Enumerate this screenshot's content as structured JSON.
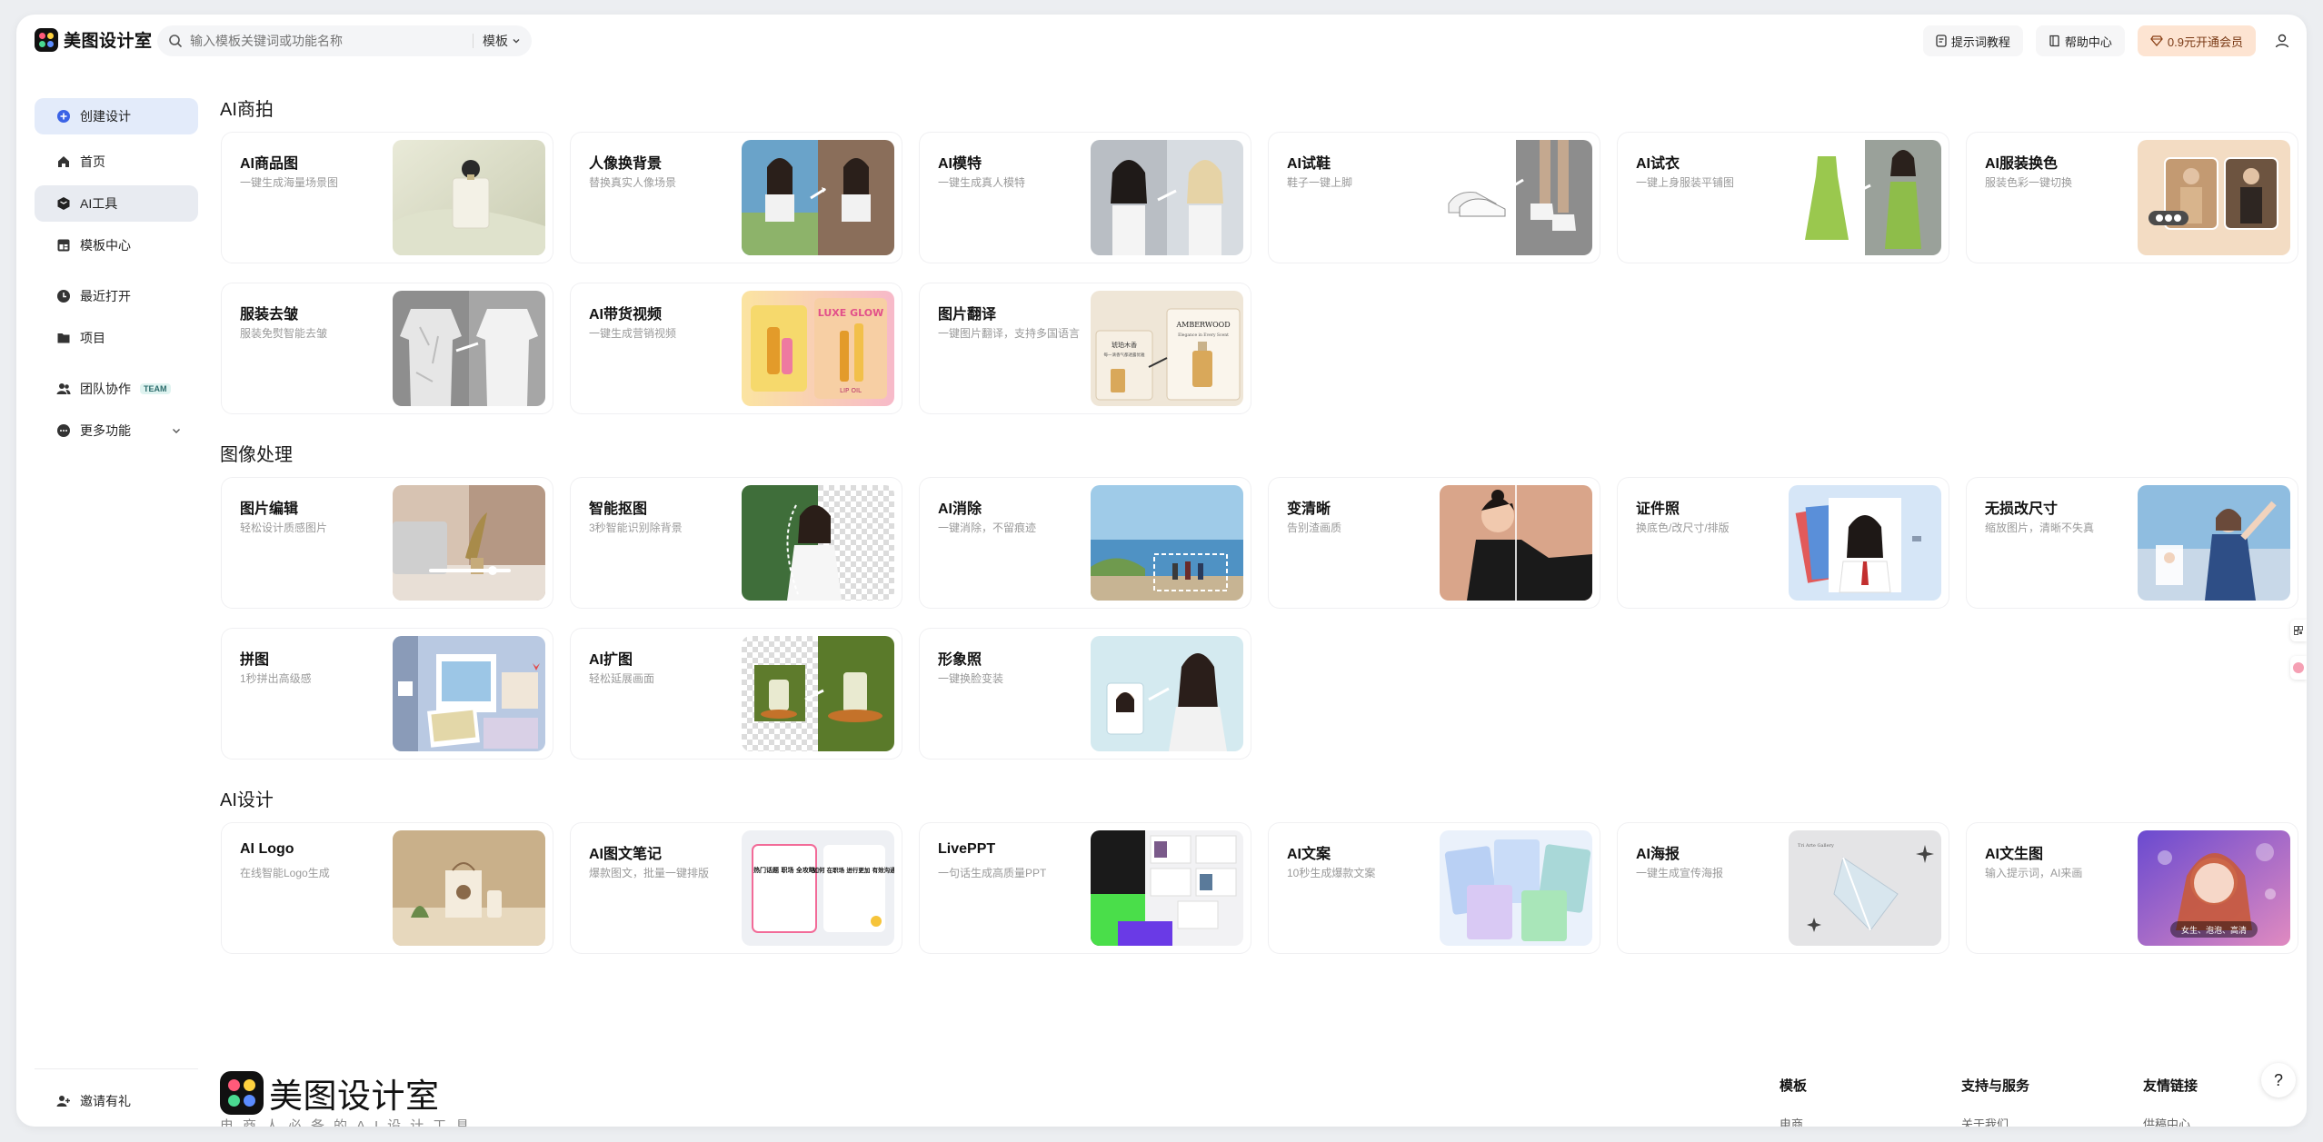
{
  "app": {
    "name": "美图设计室",
    "footer_slogan": "电商人必备的AI设计工具"
  },
  "header": {
    "search_placeholder": "输入模板关键词或功能名称",
    "search_scope": "模板",
    "prompt_tutorial": "提示词教程",
    "help_center": "帮助中心",
    "vip": "0.9元开通会员"
  },
  "sidebar": {
    "create": "创建设计",
    "home": "首页",
    "ai_tools": "AI工具",
    "templates": "模板中心",
    "recent": "最近打开",
    "projects": "项目",
    "team": "团队协作",
    "team_badge": "TEAM",
    "more": "更多功能",
    "invite": "邀请有礼"
  },
  "sections": [
    {
      "title": "AI商拍",
      "cards": [
        {
          "title": "AI商品图",
          "desc": "一键生成海量场景图"
        },
        {
          "title": "人像换背景",
          "desc": "替换真实人像场景"
        },
        {
          "title": "AI模特",
          "desc": "一键生成真人模特"
        },
        {
          "title": "AI试鞋",
          "desc": "鞋子一键上脚"
        },
        {
          "title": "AI试衣",
          "desc": "一键上身服装平铺图"
        },
        {
          "title": "AI服装换色",
          "desc": "服装色彩一键切换"
        },
        {
          "title": "服装去皱",
          "desc": "服装免熨智能去皱"
        },
        {
          "title": "AI带货视频",
          "desc": "一键生成营销视频"
        },
        {
          "title": "图片翻译",
          "desc": "一键图片翻译，支持多国语言"
        }
      ]
    },
    {
      "title": "图像处理",
      "cards": [
        {
          "title": "图片编辑",
          "desc": "轻松设计质感图片"
        },
        {
          "title": "智能抠图",
          "desc": "3秒智能识别除背景"
        },
        {
          "title": "AI消除",
          "desc": "一键消除，不留痕迹"
        },
        {
          "title": "变清晰",
          "desc": "告别渣画质"
        },
        {
          "title": "证件照",
          "desc": "换底色/改尺寸/排版"
        },
        {
          "title": "无损改尺寸",
          "desc": "缩放图片，清晰不失真"
        },
        {
          "title": "拼图",
          "desc": "1秒拼出高级感"
        },
        {
          "title": "AI扩图",
          "desc": "轻松延展画面"
        },
        {
          "title": "形象照",
          "desc": "一键换脸变装"
        }
      ]
    },
    {
      "title": "AI设计",
      "cards": [
        {
          "title": "AI Logo",
          "desc": "在线智能Logo生成"
        },
        {
          "title": "AI图文笔记",
          "desc": "爆款图文，批量一键排版"
        },
        {
          "title": "LivePPT",
          "desc": "一句话生成高质量PPT"
        },
        {
          "title": "AI文案",
          "desc": "10秒生成爆款文案"
        },
        {
          "title": "AI海报",
          "desc": "一键生成宣传海报"
        },
        {
          "title": "AI文生图",
          "desc": "输入提示词，AI来画"
        }
      ]
    }
  ],
  "thumb_text": {
    "glow_title": "LUXE GLOW",
    "glow_sub": "LIP OIL",
    "amber_title": "AMBERWOOD",
    "amber_sub": "Elegance in Every Scent",
    "amber_cn": "琥珀木香",
    "amber_cn_sub": "每一滴香气都透露优雅",
    "note_left": "热门话题 职场 全攻略",
    "note_right": "如何 在职场 进行更加 有效沟通",
    "poster_brand": "Tri Arte Gallery",
    "paint_tag": "女生、泡泡、高清"
  },
  "footer": {
    "col1_title": "模板",
    "col1_item": "电商",
    "col2_title": "支持与服务",
    "col2_item": "关于我们",
    "col3_title": "友情链接",
    "col3_item": "供稿中心",
    "help": "?"
  },
  "colors": {
    "accent": "#3b63e6",
    "vip_bg": "#fde4d2",
    "active_bg": "#e8ebf1"
  }
}
